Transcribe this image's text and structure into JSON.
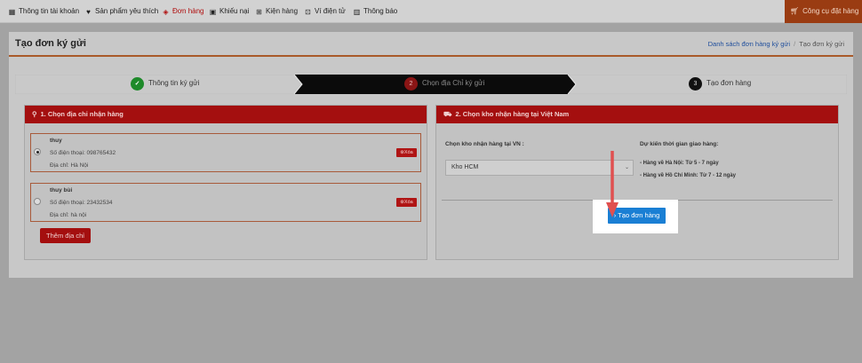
{
  "nav": {
    "items": [
      {
        "label": "Thông tin tài khoản",
        "icon": "grid-icon"
      },
      {
        "label": "Sản phẩm yêu thích",
        "icon": "heart-icon"
      },
      {
        "label": "Đơn hàng",
        "icon": "layers-icon"
      },
      {
        "label": "Khiếu nại",
        "icon": "comment-icon"
      },
      {
        "label": "Kiện hàng",
        "icon": "box-icon"
      },
      {
        "label": "Ví điện tử",
        "icon": "wallet-icon"
      },
      {
        "label": "Thông báo",
        "icon": "book-icon"
      }
    ],
    "active_index": 2,
    "tool_button": "Công cụ đặt hàng"
  },
  "page": {
    "title": "Tạo đơn ký gửi",
    "breadcrumb": {
      "link": "Danh sách đơn hàng ký gửi",
      "current": "Tạo đơn ký gửi"
    }
  },
  "steps": [
    {
      "number": "✓",
      "label": "Thông tin ký gửi",
      "state": "done"
    },
    {
      "number": "2",
      "label": "Chọn địa Chỉ ký gửi",
      "state": "active"
    },
    {
      "number": "3",
      "label": "Tạo đơn hàng",
      "state": "pending"
    }
  ],
  "address_card": {
    "title": "1. Chọn địa chỉ nhận hàng",
    "addresses": [
      {
        "name": "thuy",
        "phone": "Số điện thoại: 098765432",
        "address": "Địa chỉ: Hà Nội",
        "selected": true,
        "delete_label": "Xóa"
      },
      {
        "name": "thuy bùi",
        "phone": "Số điện thoại: 23432534",
        "address": "Địa chỉ: hà nội",
        "selected": false,
        "delete_label": "Xóa"
      }
    ],
    "add_button": "Thêm địa chỉ"
  },
  "warehouse_card": {
    "title": "2. Chọn kho nhận hàng tại Việt Nam",
    "select_label": "Chọn kho nhận hàng tại VN :",
    "selected": "Kho HCM",
    "eta_title": "Dự kiến thời gian giao hàng:",
    "eta_lines": [
      "- Hàng về Hà Nội: Từ 5 - 7 ngày",
      "- Hàng về Hồ Chí Minh: Từ 7 - 12 ngày"
    ]
  },
  "create_button": "Tạo đơn hàng",
  "colors": {
    "accent": "#a40f0f",
    "primary_button": "#1a7fd4",
    "annotation_arrow": "#e05050"
  }
}
